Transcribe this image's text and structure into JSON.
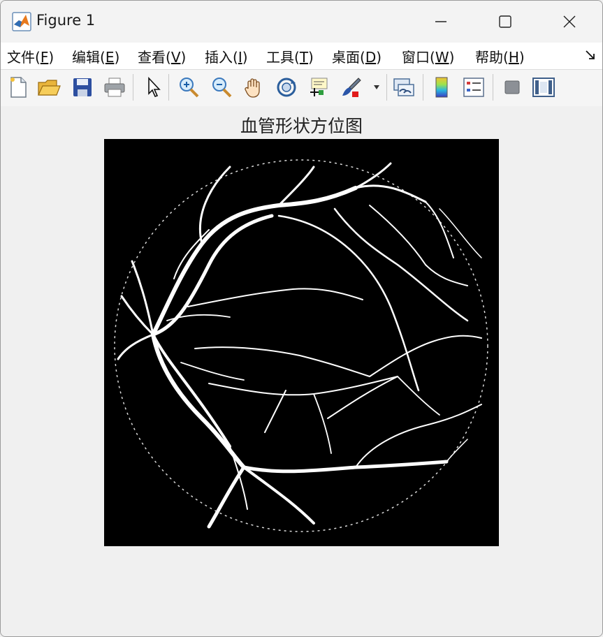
{
  "window": {
    "title": "Figure 1"
  },
  "menu": [
    {
      "label": "文件(",
      "key": "F",
      "end": ")"
    },
    {
      "label": "编辑(",
      "key": "E",
      "end": ")"
    },
    {
      "label": "查看(",
      "key": "V",
      "end": ")"
    },
    {
      "label": "插入(",
      "key": "I",
      "end": ")"
    },
    {
      "label": "工具(",
      "key": "T",
      "end": ")"
    },
    {
      "label": "桌面(",
      "key": "D",
      "end": ")"
    },
    {
      "label": "窗口(",
      "key": "W",
      "end": ")"
    },
    {
      "label": "帮助(",
      "key": "H",
      "end": ")"
    }
  ],
  "toolbar": [
    "new-figure-icon",
    "open-file-icon",
    "save-icon",
    "print-icon",
    "pointer-icon",
    "zoom-in-icon",
    "zoom-out-icon",
    "pan-hand-icon",
    "rotate-3d-icon",
    "data-cursor-icon",
    "brush-icon",
    "link-plot-icon",
    "colorbar-icon",
    "legend-icon",
    "hide-plot-tools-icon",
    "show-plot-tools-icon"
  ],
  "plot": {
    "title": "血管形状方位图"
  },
  "colors": {
    "accent": "#e87a1e",
    "image_bg": "#000000",
    "vessel": "#ffffff"
  }
}
